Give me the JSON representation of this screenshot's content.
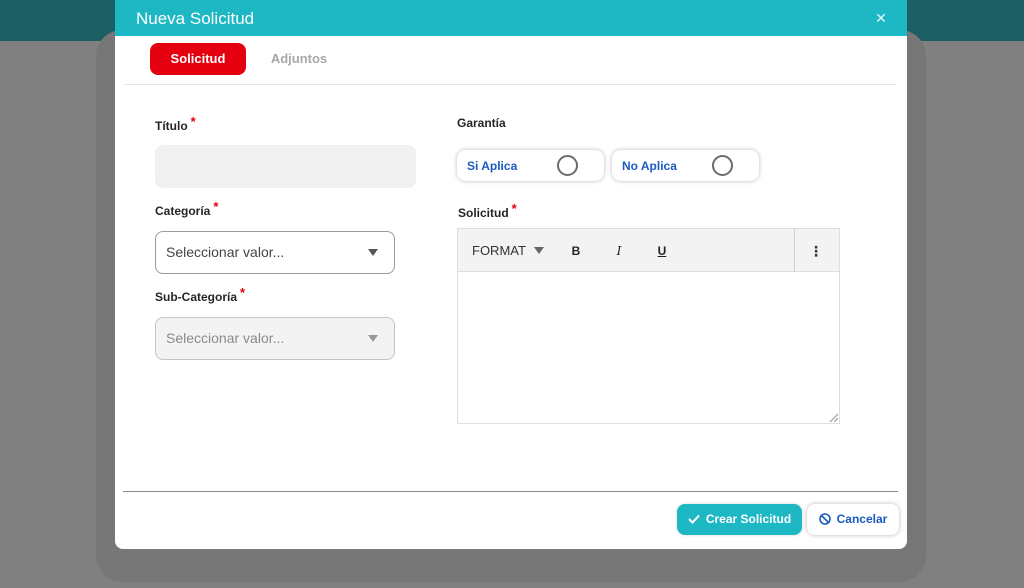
{
  "modal": {
    "title": "Nueva Solicitud",
    "close_glyph": "✕"
  },
  "tabs": [
    {
      "label": "Solicitud",
      "active": true
    },
    {
      "label": "Adjuntos",
      "active": false
    }
  ],
  "form": {
    "titulo": {
      "label": "Título",
      "required_mark": "*",
      "value": ""
    },
    "categoria": {
      "label": "Categoría",
      "required_mark": "*",
      "placeholder": "Seleccionar valor..."
    },
    "subcategoria": {
      "label": "Sub-Categoría",
      "required_mark": "*",
      "placeholder": "Seleccionar valor...",
      "disabled": true
    },
    "garantia": {
      "label": "Garantía",
      "options": [
        {
          "label": "Si Aplica",
          "selected": false
        },
        {
          "label": "No Aplica",
          "selected": false
        }
      ]
    },
    "solicitud": {
      "label": "Solicitud",
      "required_mark": "*",
      "toolbar": {
        "format": "FORMAT",
        "bold": "B",
        "italic": "I",
        "underline": "U",
        "more": "⋮"
      },
      "value": ""
    }
  },
  "footer": {
    "submit_label": "Crear Solicitud",
    "cancel_label": "Cancelar"
  },
  "colors": {
    "header": "#1eb8c5",
    "tab_active": "#e4000f",
    "required": "#e4000f",
    "link_blue": "#1a5bbd"
  },
  "icons": {
    "close": "close-icon",
    "submit": "check-icon",
    "cancel": "ban-icon",
    "caret": "caret-down-icon"
  }
}
